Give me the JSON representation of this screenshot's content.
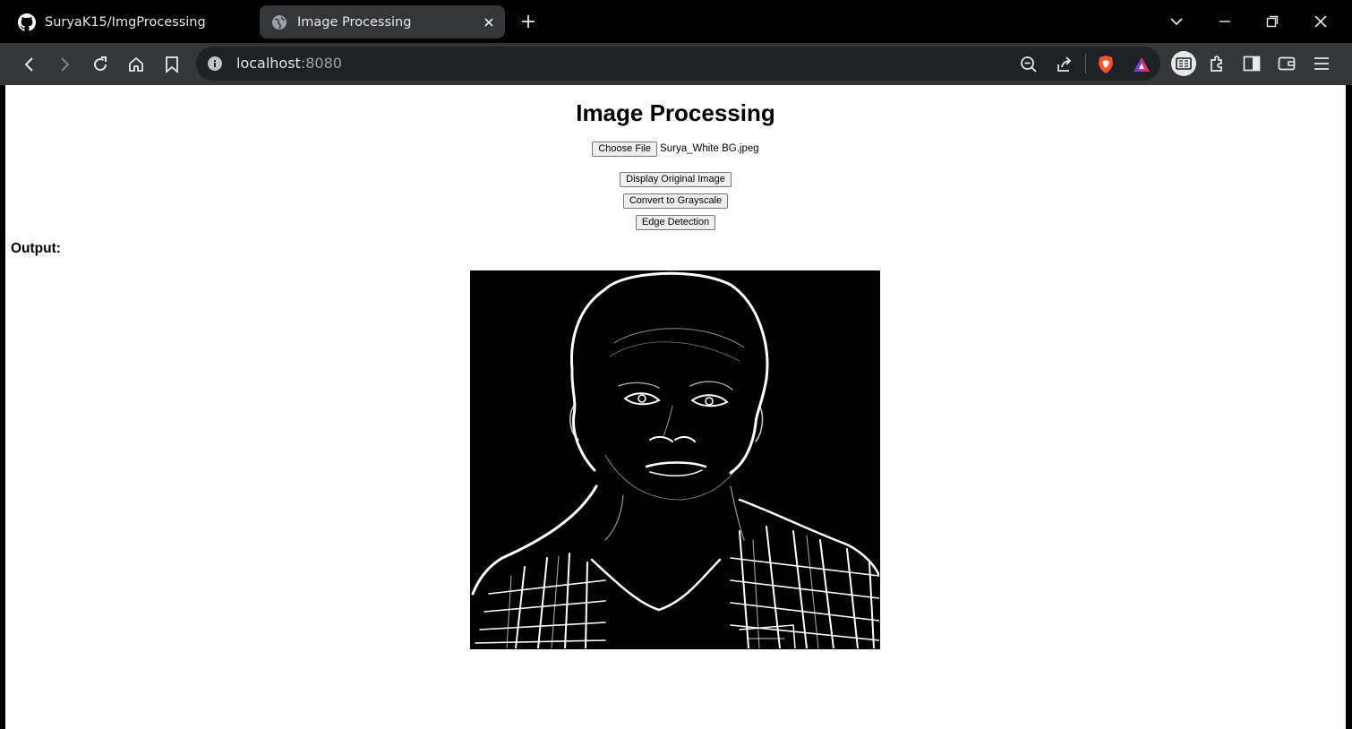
{
  "browser": {
    "tabs": [
      {
        "title": "SuryaK15/ImgProcessing",
        "favicon": "github-icon",
        "active": false
      },
      {
        "title": "Image Processing",
        "favicon": "globe-icon",
        "active": true
      }
    ],
    "url_host": "localhost",
    "url_port": ":8080"
  },
  "page": {
    "title": "Image Processing",
    "file_button_label": "Choose File",
    "file_name": "Surya_White BG.jpeg",
    "buttons": {
      "display_original": "Display Original Image",
      "grayscale": "Convert to Grayscale",
      "edge_detection": "Edge Detection"
    },
    "output_label": "Output:"
  },
  "colors": {
    "tabbar_bg": "#000000",
    "toolbar_bg": "#35363a",
    "omnibox_bg": "#202124",
    "brave_accent": "#fb542b"
  }
}
